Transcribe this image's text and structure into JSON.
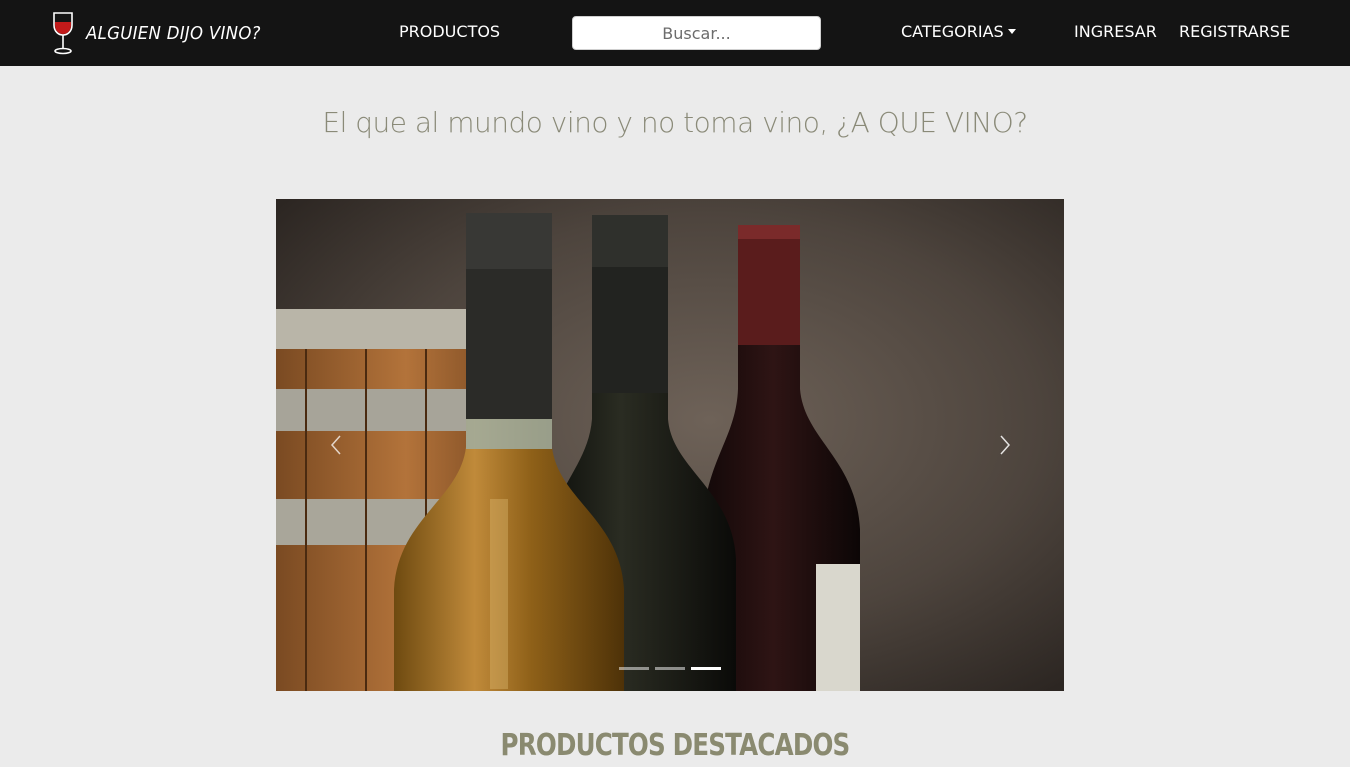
{
  "navbar": {
    "brand_text": "ALGUIEN DIJO VINO?",
    "brand_icon": "wine-glass-icon",
    "productos_label": "PRODUCTOS",
    "search_placeholder": "Buscar...",
    "categorias_label": "CATEGORIAS",
    "ingresar_label": "INGRESAR",
    "registrarse_label": "REGISTRARSE"
  },
  "hero": {
    "tagline": "El que al mundo vino y no toma vino, ¿A QUE VINO?"
  },
  "carousel": {
    "slide_description_icon": "wine-bottles-photo",
    "prev_icon": "chevron-left-icon",
    "next_icon": "chevron-right-icon",
    "slide_count": 3,
    "active_slide": 3
  },
  "featured": {
    "title": "PRODUCTOS DESTACADOS"
  },
  "colors": {
    "navbar_bg": "#141414",
    "page_bg": "#ebebeb",
    "tagline": "#8a8a78",
    "section_title": "#8a8a70"
  }
}
